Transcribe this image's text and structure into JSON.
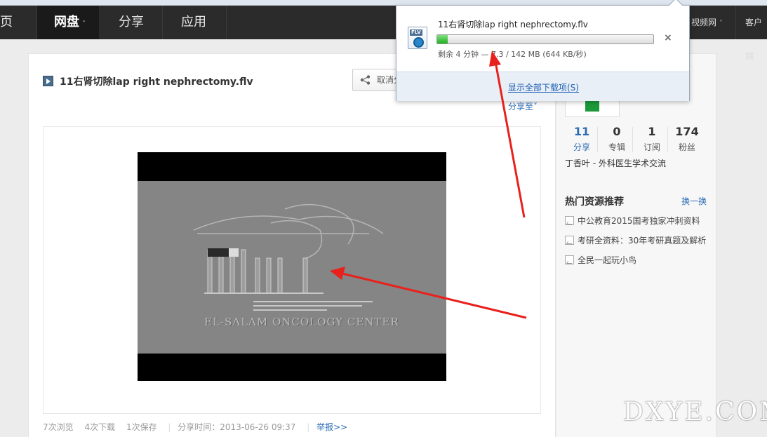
{
  "nav": {
    "home_label": "页",
    "items": [
      {
        "label": "网盘",
        "caret": "˅"
      },
      {
        "label": "分享"
      },
      {
        "label": "应用"
      }
    ],
    "right_video": "视频网",
    "right_caret": "˅",
    "right_client": "客户端"
  },
  "main": {
    "file_title": "11右肾切除lap right nephrectomy.flv",
    "cancel_share_label": "取消分享",
    "share_to_label": "分享至˅",
    "video_logo_text": "EL-SALAM ONCOLOGY CENTER",
    "stats": {
      "views": "7次浏览",
      "downloads": "4次下载",
      "saves": "1次保存",
      "share_time": "分享时间：2013-06-26 09:37",
      "report": "举报>>"
    }
  },
  "sidebar": {
    "stats": [
      {
        "num": "11",
        "label": "分享"
      },
      {
        "num": "0",
        "label": "专辑"
      },
      {
        "num": "1",
        "label": "订阅"
      },
      {
        "num": "174",
        "label": "粉丝"
      }
    ],
    "user_name": "丁香叶 - 外科医生学术交流",
    "hot_title": "热门资源推荐",
    "refresh_label": "换一换",
    "resources": [
      "中公教育2015国考独家冲刺资料",
      "考研全资料：30年考研真题及解析",
      "全民一起玩小鸟"
    ]
  },
  "download": {
    "badge": "FLV",
    "file_name": "11右肾切除lap right nephrectomy.flv",
    "progress_fraction": 0.05,
    "status": "剩余 4 分钟 — 7.3 / 142 MB (644 KB/秒)",
    "close_glyph": "×",
    "show_all_label": "显示全部下载项(S)"
  },
  "watermark": "DXYE.COM",
  "colors": {
    "link_blue": "#2d6db5",
    "nav_bg": "#2b2b2b",
    "progress_green": "#22b022",
    "arrow_red": "#e8211c"
  }
}
